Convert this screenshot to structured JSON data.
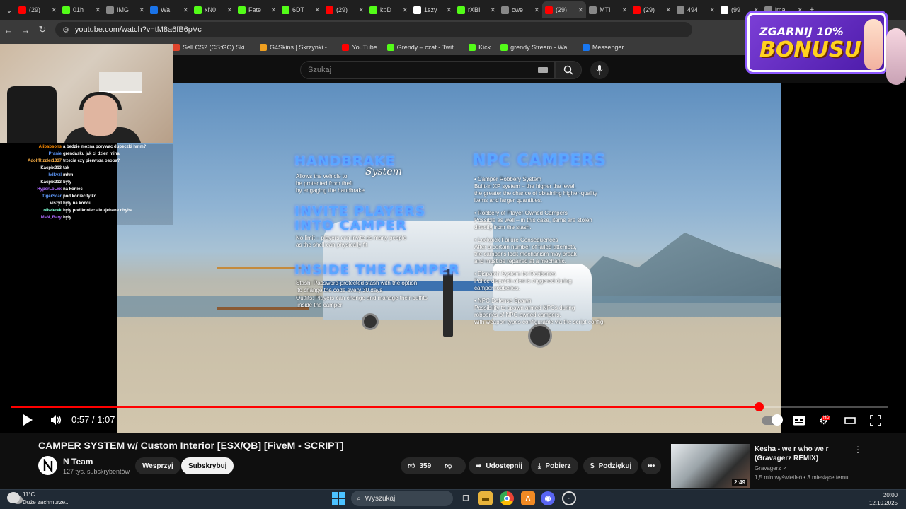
{
  "browser": {
    "tabs": [
      {
        "label": "(29)",
        "favicon": "youtube",
        "color": "#ff0000"
      },
      {
        "label": "01h",
        "favicon": "kick",
        "color": "#53fc18"
      },
      {
        "label": "IMG",
        "favicon": "globe",
        "color": "#888888"
      },
      {
        "label": "Wa",
        "favicon": "generic",
        "color": "#1a73e8"
      },
      {
        "label": "xN0",
        "favicon": "kick",
        "color": "#53fc18"
      },
      {
        "label": "Fate",
        "favicon": "kick",
        "color": "#53fc18"
      },
      {
        "label": "6DT",
        "favicon": "kick",
        "color": "#53fc18"
      },
      {
        "label": "(29)",
        "favicon": "youtube",
        "color": "#ff0000"
      },
      {
        "label": "kpD",
        "favicon": "kick",
        "color": "#53fc18"
      },
      {
        "label": "1szy",
        "favicon": "gmail",
        "color": "#ffffff"
      },
      {
        "label": "rXBI",
        "favicon": "kick",
        "color": "#53fc18"
      },
      {
        "label": "cwe",
        "favicon": "globe",
        "color": "#888888"
      },
      {
        "label": "(29)",
        "favicon": "youtube",
        "color": "#ff0000",
        "active": true
      },
      {
        "label": "MTI",
        "favicon": "globe",
        "color": "#888888"
      },
      {
        "label": "(29)",
        "favicon": "youtube",
        "color": "#ff0000"
      },
      {
        "label": "494",
        "favicon": "globe",
        "color": "#888888"
      },
      {
        "label": "(99",
        "favicon": "tiktok",
        "color": "#ffffff"
      },
      {
        "label": "ima",
        "favicon": "globe",
        "color": "#888888"
      }
    ],
    "new_tab": "+",
    "url": "youtube.com/watch?v=tM8a6fB6pVc",
    "bookmarks": [
      {
        "label": "Sell CS2 (CS:GO) Ski...",
        "color": "#e0442c"
      },
      {
        "label": "G4Skins | Skrzynki -...",
        "color": "#f0a020"
      },
      {
        "label": "YouTube",
        "color": "#ff0000"
      },
      {
        "label": "Grendy – czat - Twit...",
        "color": "#53fc18"
      },
      {
        "label": "Kick",
        "color": "#53fc18"
      },
      {
        "label": "grendy Stream - Wa...",
        "color": "#53fc18"
      },
      {
        "label": "Messenger",
        "color": "#1877f2"
      }
    ]
  },
  "youtube": {
    "search_placeholder": "Szukaj",
    "video": {
      "sections": {
        "handbrake": {
          "title": "HANDBRAKE",
          "script_word": "System",
          "body": "Allows the vehicle to\nbe protected from theft\nby engaging the handbrake"
        },
        "invite": {
          "title_1": "INVITE PLAYERS",
          "title_2": "INTO CAMPER",
          "body": "No limit – players can invite as many people\nas the shell can physically fit"
        },
        "inside": {
          "title": "INSIDE THE CAMPER",
          "body_1": "Stash: Password-protected stash with the option\n to change the code every 30 days",
          "body_2": "Outfits: Players can change and manage their outfits\n inside the camper"
        },
        "npc": {
          "title": "NPC CAMPERS",
          "items": [
            {
              "head": "Camper Robbery System",
              "body": "Built-in XP system – the higher the level,\nthe greater the chance of obtaining higher-quality\nitems and larger quantities."
            },
            {
              "head": "Robbery of Player-Owned Campers",
              "body": "Possible as well – in this case, items are stolen\ndirectly from the stash."
            },
            {
              "head": "Lockpick Failure Consequences",
              "body": "After a certain number of failed attempts,\nthe camper's lock mechanism may break\nand must be repaired at a mechanic."
            },
            {
              "head": "Dispatch System for Robberies",
              "body": "Police dispatch alert is triggered during\ncamper robberies."
            },
            {
              "head": "NPC Defense Spawn",
              "body": "Possibility to spawn armed NPCs during\nrobberies of NPC-owned campers,\nwith weapon types configurable via the script config."
            }
          ]
        }
      }
    },
    "player": {
      "current_time": "0:57",
      "separator": " / ",
      "duration": "1:07",
      "progress_fraction": 0.853,
      "hd_badge": "HD"
    },
    "title": "CAMPER SYSTEM w/ Custom Interior [ESX/QB] [FiveM - SCRIPT]",
    "channel": {
      "name": "N Team",
      "subs": "127 tys. subskrybentów"
    },
    "buttons": {
      "support": "Wesprzyj",
      "subscribe": "Subskrybuj",
      "likes": "359",
      "share": "Udostępnij",
      "download": "Pobierz",
      "thanks": "Podziękuj",
      "more": "•••"
    },
    "recommendation": {
      "title": "Kesha - we r who we r (Gravagerz REMIX)",
      "channel": "Gravagerz",
      "verified": "✓",
      "meta": "1,5 mln wyświetleń • 3 miesiące temu",
      "duration": "2:49"
    }
  },
  "stream_overlay": {
    "chat": [
      {
        "user": "Alibabsons",
        "color": "#ff8c00",
        "text": "a bedzie mozna porywac dupeczki hmm?"
      },
      {
        "user": "Pranie",
        "color": "#5f9bff",
        "text": "grendasku jak ci dzien minal"
      },
      {
        "user": "AdolfRizzler1337",
        "color": "#ffb347",
        "text": "trzecia czy pierwsza osoba?"
      },
      {
        "user": "Kacpix213",
        "color": "#ffffff",
        "text": "tak"
      },
      {
        "user": "hdkvzl",
        "color": "#5f9bff",
        "text": "mhm"
      },
      {
        "user": "Kacpix213",
        "color": "#ffffff",
        "text": "byly"
      },
      {
        "user": "HyperLoLxx",
        "color": "#b06bff",
        "text": "na koniec"
      },
      {
        "user": "TigerScar",
        "color": "#5f9bff",
        "text": "pod koniec tylko"
      },
      {
        "user": "viszyl",
        "color": "#ffffff",
        "text": "byly na koncu"
      },
      {
        "user": "oliwierek",
        "color": "#7fffd4",
        "text": "byly pod koniec ale zjebane chyba"
      },
      {
        "user": "MsN_Bary",
        "color": "#b06bff",
        "text": "byly"
      }
    ],
    "promo": {
      "line1": "ZGARNIJ 10%",
      "line2": "BONUSU"
    }
  },
  "taskbar": {
    "weather_temp": "11°C",
    "weather_desc": "Duże zachmurze...",
    "search": "Wyszukaj",
    "time": "20:00",
    "date": "12.10.2025"
  }
}
